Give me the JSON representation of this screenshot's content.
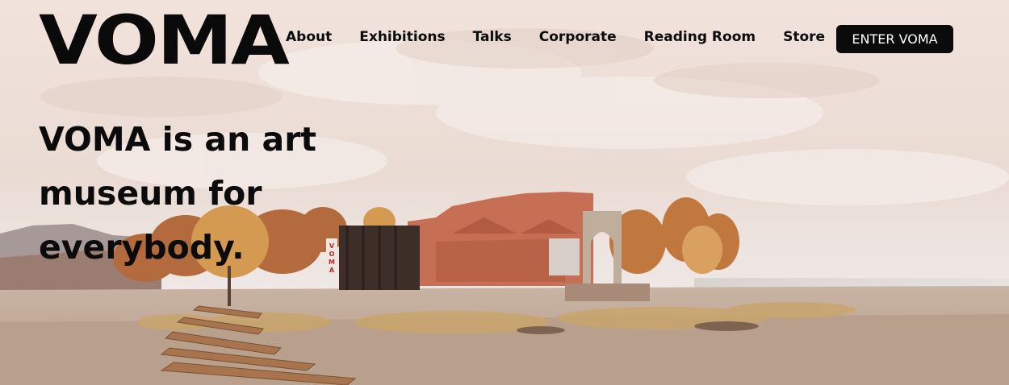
{
  "header": {
    "logo_text": "VOMA",
    "nav": [
      "About",
      "Exhibitions",
      "Talks",
      "Corporate",
      "Reading Room",
      "Store"
    ],
    "cta_label": "ENTER VOMA"
  },
  "hero": {
    "headline": "VOMA is an art museum for everybody.",
    "building_sign": "VOMA"
  }
}
